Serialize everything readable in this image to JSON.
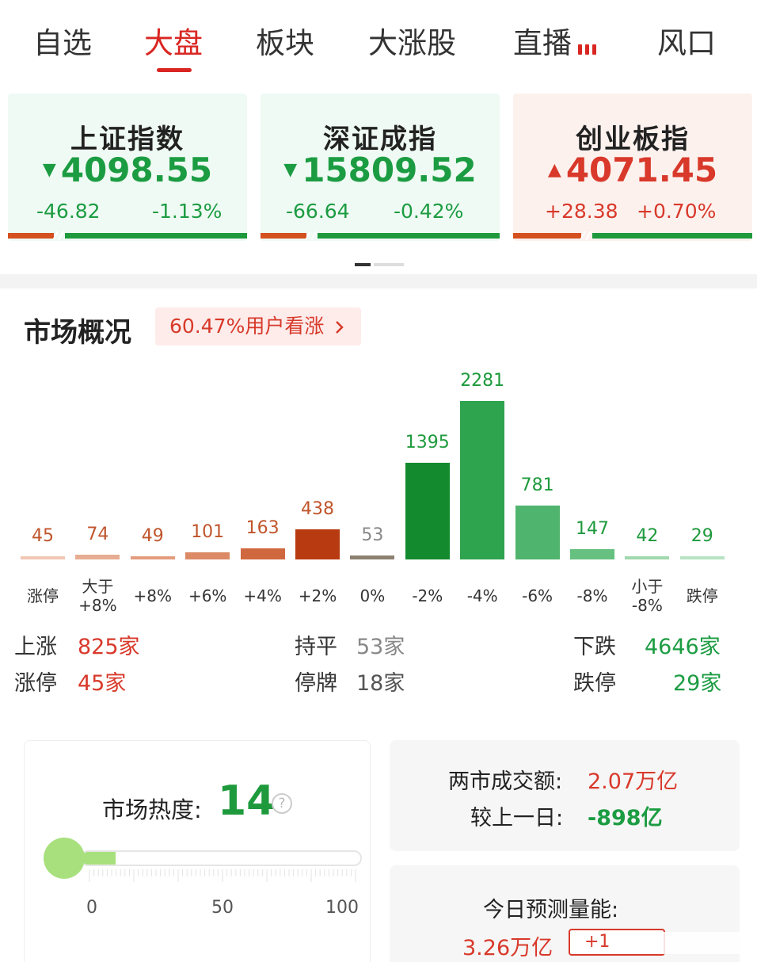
{
  "tabs": [
    {
      "label": "自选",
      "active": false
    },
    {
      "label": "大盘",
      "active": true
    },
    {
      "label": "板块",
      "active": false
    },
    {
      "label": "大涨股",
      "active": false
    },
    {
      "label": "直播",
      "active": false,
      "icon": "live-bars-icon"
    },
    {
      "label": "风口",
      "active": false
    }
  ],
  "indices": [
    {
      "name": "上证指数",
      "value": "4098.55",
      "change": "-46.82",
      "percent": "-1.13%",
      "direction": "down",
      "up_ratio": 0.2
    },
    {
      "name": "深证成指",
      "value": "15809.52",
      "change": "-66.64",
      "percent": "-0.42%",
      "direction": "down",
      "up_ratio": 0.2
    },
    {
      "name": "创业板指",
      "value": "4071.45",
      "change": "+28.38",
      "percent": "+0.70%",
      "direction": "up",
      "up_ratio": 0.3
    }
  ],
  "overview": {
    "title": "市场概况",
    "sentiment": "60.47%用户看涨",
    "sentiment_icon": "chevron-right-icon"
  },
  "chart_data": {
    "type": "bar",
    "categories": [
      "涨停",
      "大于+8%",
      "+8%",
      "+6%",
      "+4%",
      "+2%",
      "0%",
      "-2%",
      "-4%",
      "-6%",
      "-8%",
      "小于-8%",
      "跌停"
    ],
    "values": [
      45,
      74,
      49,
      101,
      163,
      438,
      53,
      1395,
      2281,
      781,
      147,
      42,
      29
    ],
    "colors": [
      "#f0c7b3",
      "#e7ad92",
      "#e29c7e",
      "#dc8a66",
      "#d0683f",
      "#b83a10",
      "#8c8070",
      "#138a2e",
      "#2ea44f",
      "#4fb46d",
      "#66c07f",
      "#9fd9ad",
      "#b7e3c2"
    ],
    "label_colors": [
      "#c0552c",
      "#c0552c",
      "#c0552c",
      "#c0552c",
      "#c0552c",
      "#c0552c",
      "#888888",
      "#1e9a3c",
      "#1e9a3c",
      "#1e9a3c",
      "#1e9a3c",
      "#1e9a3c",
      "#1e9a3c"
    ]
  },
  "stats": {
    "up_label": "上涨",
    "up_value": "825家",
    "flat_label": "持平",
    "flat_value": "53家",
    "down_label": "下跌",
    "down_value": "4646家",
    "limit_up_label": "涨停",
    "limit_up_value": "45家",
    "suspended_label": "停牌",
    "suspended_value": "18家",
    "limit_down_label": "跌停",
    "limit_down_value": "29家"
  },
  "heat": {
    "label": "市场热度:",
    "value": "14",
    "level": 14,
    "help_icon": "question-icon",
    "scale": [
      "0",
      "50",
      "100"
    ]
  },
  "turnover": {
    "label": "两市成交额:",
    "value": "2.07万亿",
    "compare_label": "较上一日:",
    "compare_value": "-898亿"
  },
  "forecast": {
    "label": "今日预测量能:",
    "value": "3.26万亿",
    "badge": "+1"
  }
}
